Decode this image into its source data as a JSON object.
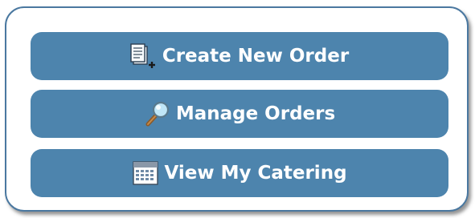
{
  "menu": {
    "buttons": [
      {
        "label": "Create New Order",
        "icon": "new-document-icon"
      },
      {
        "label": "Manage Orders",
        "icon": "magnifier-icon"
      },
      {
        "label": "View My Catering",
        "icon": "calendar-icon"
      }
    ]
  },
  "colors": {
    "button_bg": "#4d84ad",
    "panel_border": "#4a78a0",
    "button_text": "#ffffff"
  }
}
